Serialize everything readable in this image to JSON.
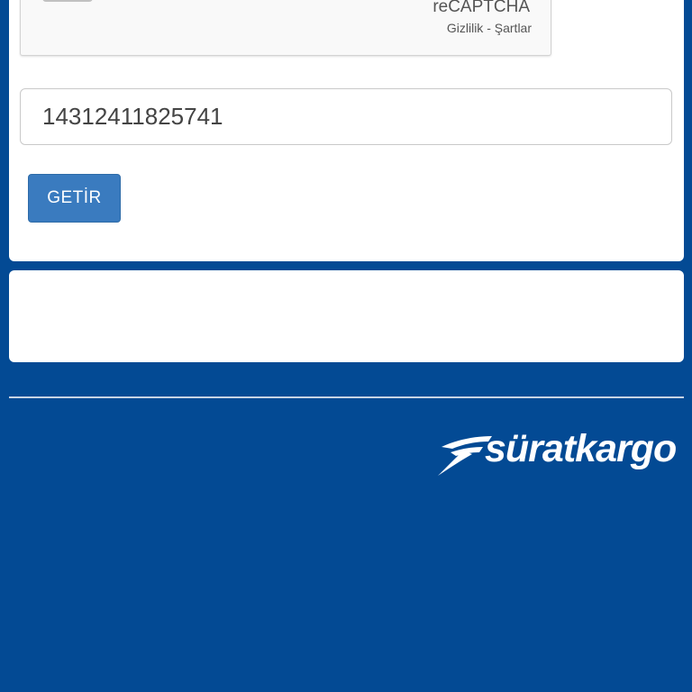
{
  "recaptcha": {
    "brand": "reCAPTCHA",
    "privacy_link": "Gizlilik",
    "separator": "-",
    "terms_link": "Şartlar"
  },
  "tracking": {
    "value": "14312411825741"
  },
  "actions": {
    "submit_label": "GETİR"
  },
  "footer": {
    "logo_text": "süratkargo"
  },
  "colors": {
    "background": "#034a94",
    "button": "#3a7bbf",
    "card": "#ffffff"
  },
  "icons": {
    "logo_mark": "swoosh-icon",
    "checkbox": "checkbox-icon"
  }
}
